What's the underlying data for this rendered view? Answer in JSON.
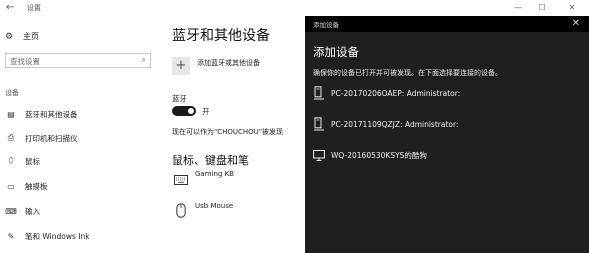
{
  "window": {
    "title": "设置",
    "controls": {
      "minimize": "—",
      "maximize": "☐",
      "close": "✕"
    }
  },
  "sidebar": {
    "home_label": "主页",
    "search_placeholder": "查找设置",
    "section_label": "设备",
    "items": [
      {
        "label": "蓝牙和其他设备",
        "icon": "bluetooth-devices-icon"
      },
      {
        "label": "打印机和扫描仪",
        "icon": "printer-icon"
      },
      {
        "label": "鼠标",
        "icon": "mouse-icon"
      },
      {
        "label": "触摸板",
        "icon": "touchpad-icon"
      },
      {
        "label": "输入",
        "icon": "keyboard-icon"
      },
      {
        "label": "笔和 Windows Ink",
        "icon": "pen-icon"
      }
    ]
  },
  "main": {
    "title": "蓝牙和其他设备",
    "add_button_label": "添加蓝牙或其他设备",
    "bluetooth_label": "蓝牙",
    "toggle_state_label": "开",
    "discoverable_text": "现在可以作为\"CHOUCHOU\"被发现",
    "section_title": "鼠标、键盘和笔",
    "devices": [
      {
        "name": "Gaming KB",
        "icon": "keyboard-icon"
      },
      {
        "name": "Usb Mouse",
        "icon": "mouse-icon"
      }
    ]
  },
  "dialog": {
    "bar_title": "添加设备",
    "title": "添加设备",
    "subtitle": "确保你的设备已打开并可被发现。在下面选择要连接的设备。",
    "devices": [
      {
        "name": "PC-20170206OAEP: Administrator:",
        "icon": "computer-icon"
      },
      {
        "name": "PC-20171109QZJZ: Administrator:",
        "icon": "computer-icon"
      },
      {
        "name": "WQ-20160530KSYS的酷狗",
        "icon": "display-icon"
      }
    ]
  },
  "colors": {
    "dialog_bg": "#1f1f1f",
    "dialog_bar": "#000000",
    "toggle_on": "#1a1a1a"
  }
}
